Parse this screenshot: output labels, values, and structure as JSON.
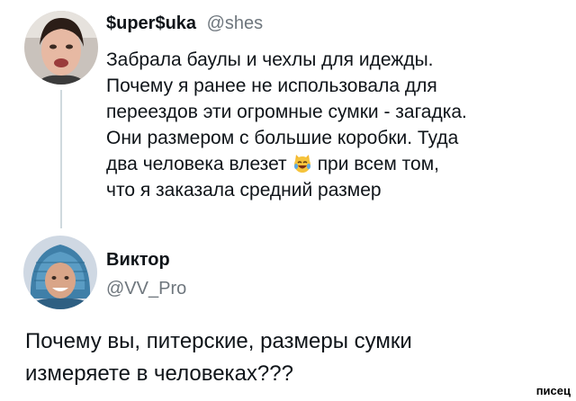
{
  "tweet1": {
    "display_name": "$uper$uka",
    "handle": "@shes",
    "lines": [
      "Забрала баулы и чехлы для идежды.",
      "Почему я ранее не использовала для",
      "переездов эти огромные сумки - загадка.",
      "Они размером с большие коробки. Туда",
      "два человека влезет",
      "при всем том,",
      "что я заказала средний размер"
    ],
    "emoji": "laughing-tears-cat-icon"
  },
  "reply": {
    "display_name": "Виктор",
    "handle": "@VV_Pro",
    "lines": [
      "Почему вы, питерские, размеры сумки",
      "измеряете в человеках???"
    ]
  },
  "watermark": "писец"
}
